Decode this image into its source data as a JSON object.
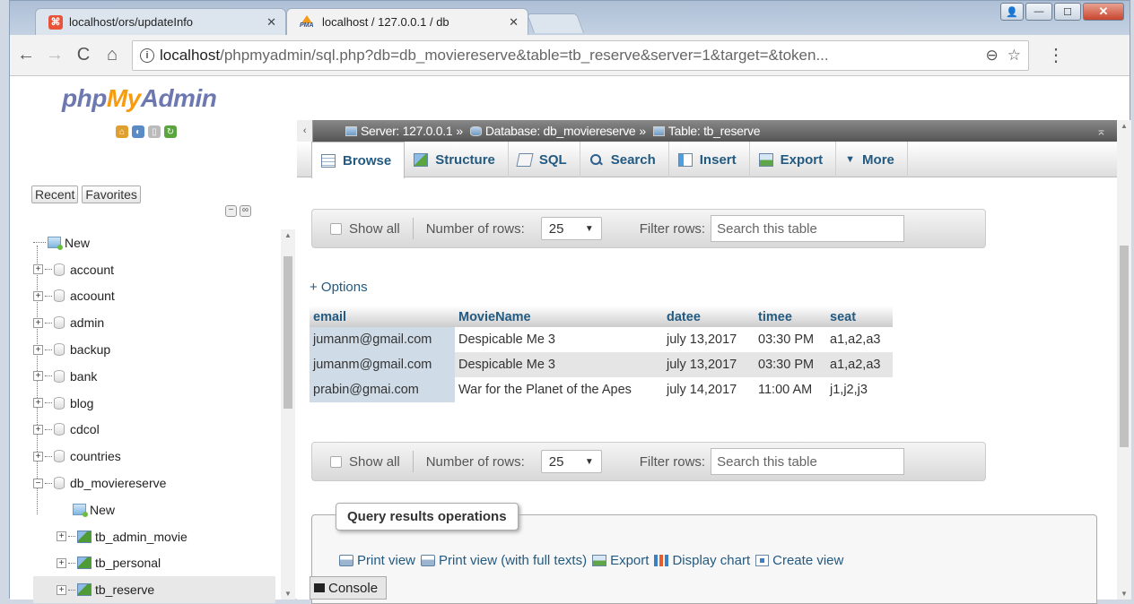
{
  "browser": {
    "tabs": [
      {
        "title": "localhost/ors/updateInfo",
        "favicon": "ors-favicon",
        "active": false
      },
      {
        "title": "localhost / 127.0.0.1 / db",
        "favicon": "phpmyadmin-favicon",
        "active": true
      }
    ],
    "close_glyph": "✕",
    "window_controls": {
      "user": "👤",
      "minimize": "—",
      "maximize": "☐",
      "close": "✕"
    },
    "nav": {
      "back": "←",
      "forward": "→",
      "reload": "C",
      "home": "⌂"
    },
    "url_host": "localhost",
    "url_rest": "/phpmyadmin/sql.php?db=db_moviereserve&table=tb_reserve&server=1&target=&token...",
    "info_glyph": "i",
    "zoom_glyph": "⊖",
    "star_glyph": "☆",
    "menu_glyph": "⋮"
  },
  "sidebar": {
    "logo_php": "php",
    "logo_my": "My",
    "logo_admin": "Admin",
    "recent": "Recent",
    "favorites": "Favorites",
    "new_label": "New",
    "databases": [
      "account",
      "acoount",
      "admin",
      "backup",
      "bank",
      "blog",
      "cdcol",
      "countries",
      "db_moviereserve"
    ],
    "db_children": [
      {
        "label": "New",
        "type": "new"
      },
      {
        "label": "tb_admin_movie",
        "type": "table"
      },
      {
        "label": "tb_personal",
        "type": "table"
      },
      {
        "label": "tb_reserve",
        "type": "table"
      }
    ]
  },
  "breadcrumb": {
    "server": "Server: 127.0.0.1",
    "database": "Database: db_moviereserve",
    "table": "Table: tb_reserve",
    "sep": "»"
  },
  "tabs": [
    {
      "label": "Browse",
      "icon": "browse-icon",
      "active": true
    },
    {
      "label": "Structure",
      "icon": "structure-icon",
      "active": false
    },
    {
      "label": "SQL",
      "icon": "sql-icon",
      "active": false
    },
    {
      "label": "Search",
      "icon": "search-icon",
      "active": false
    },
    {
      "label": "Insert",
      "icon": "insert-icon",
      "active": false
    },
    {
      "label": "Export",
      "icon": "export-icon",
      "active": false
    },
    {
      "label": "More",
      "icon": "more-icon",
      "active": false
    }
  ],
  "filter": {
    "show_all": "Show all",
    "number_of_rows": "Number of rows:",
    "rows_value": "25",
    "filter_rows": "Filter rows:",
    "search_placeholder": "Search this table"
  },
  "options_label": "+ Options",
  "table": {
    "columns": [
      "email",
      "MovieName",
      "datee",
      "timee",
      "seat"
    ],
    "rows": [
      [
        "jumanm@gmail.com",
        "Despicable Me 3",
        "july 13,2017",
        "03:30 PM",
        "a1,a2,a3"
      ],
      [
        "jumanm@gmail.com",
        "Despicable Me 3",
        "july 13,2017",
        "03:30 PM",
        "a1,a2,a3"
      ],
      [
        "prabin@gmai.com",
        "War for the Planet of the Apes",
        "july 14,2017",
        "11:00 AM",
        "j1,j2,j3"
      ]
    ]
  },
  "query_ops": {
    "legend": "Query results operations",
    "links": [
      {
        "label": "Print view",
        "icon": "print-icon"
      },
      {
        "label": "Print view (with full texts)",
        "icon": "print-icon"
      },
      {
        "label": "Export",
        "icon": "export-icon"
      },
      {
        "label": "Display chart",
        "icon": "chart-icon"
      },
      {
        "label": "Create view",
        "icon": "create-view-icon"
      }
    ]
  },
  "console_label": "Console",
  "colors": {
    "link_blue": "#235a81",
    "logo_blue": "#6c78af",
    "logo_orange": "#f89c0e",
    "breadcrumb_bg": "#6b6b6b"
  }
}
